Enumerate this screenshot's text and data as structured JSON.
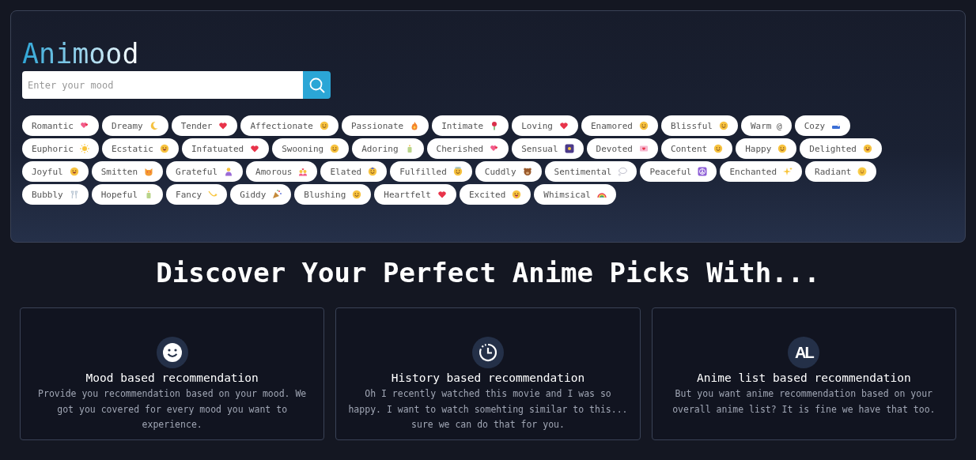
{
  "brand": "Animood",
  "search": {
    "placeholder": "Enter your mood"
  },
  "moods": [
    {
      "label": "Romantic"
    },
    {
      "label": "Dreamy"
    },
    {
      "label": "Tender"
    },
    {
      "label": "Affectionate"
    },
    {
      "label": "Passionate"
    },
    {
      "label": "Intimate"
    },
    {
      "label": "Loving"
    },
    {
      "label": "Enamored"
    },
    {
      "label": "Blissful"
    },
    {
      "label": "Warm @"
    },
    {
      "label": "Cozy"
    },
    {
      "label": "Euphoric"
    },
    {
      "label": "Ecstatic"
    },
    {
      "label": "Infatuated"
    },
    {
      "label": "Swooning"
    },
    {
      "label": "Adoring"
    },
    {
      "label": "Cherished"
    },
    {
      "label": "Sensual"
    },
    {
      "label": "Devoted"
    },
    {
      "label": "Content"
    },
    {
      "label": "Happy"
    },
    {
      "label": "Delighted"
    },
    {
      "label": "Joyful"
    },
    {
      "label": "Smitten"
    },
    {
      "label": "Grateful"
    },
    {
      "label": "Amorous"
    },
    {
      "label": "Elated"
    },
    {
      "label": "Fulfilled"
    },
    {
      "label": "Cuddly"
    },
    {
      "label": "Sentimental"
    },
    {
      "label": "Peaceful"
    },
    {
      "label": "Enchanted"
    },
    {
      "label": "Radiant"
    },
    {
      "label": "Bubbly"
    },
    {
      "label": "Hopeful"
    },
    {
      "label": "Fancy"
    },
    {
      "label": "Giddy"
    },
    {
      "label": "Blushing"
    },
    {
      "label": "Heartfelt"
    },
    {
      "label": "Excited"
    },
    {
      "label": "Whimsical"
    }
  ],
  "heading": "Discover Your Perfect Anime Picks With...",
  "features": [
    {
      "kind": "smiley",
      "title": "Mood based recommendation",
      "text": "Provide you recommendation based on your mood. We got you covered for every mood you want to experience."
    },
    {
      "kind": "clock",
      "title": "History based recommendation",
      "text": "Oh I recently watched this movie and I was so happy. I want to watch somehting similar to this... sure we can do that for you."
    },
    {
      "kind": "logo",
      "logo_text": "AL",
      "title": "Anime list based recommendation",
      "text": "But you want anime recommendation based on your overall anime list? It is fine we have that too."
    }
  ]
}
